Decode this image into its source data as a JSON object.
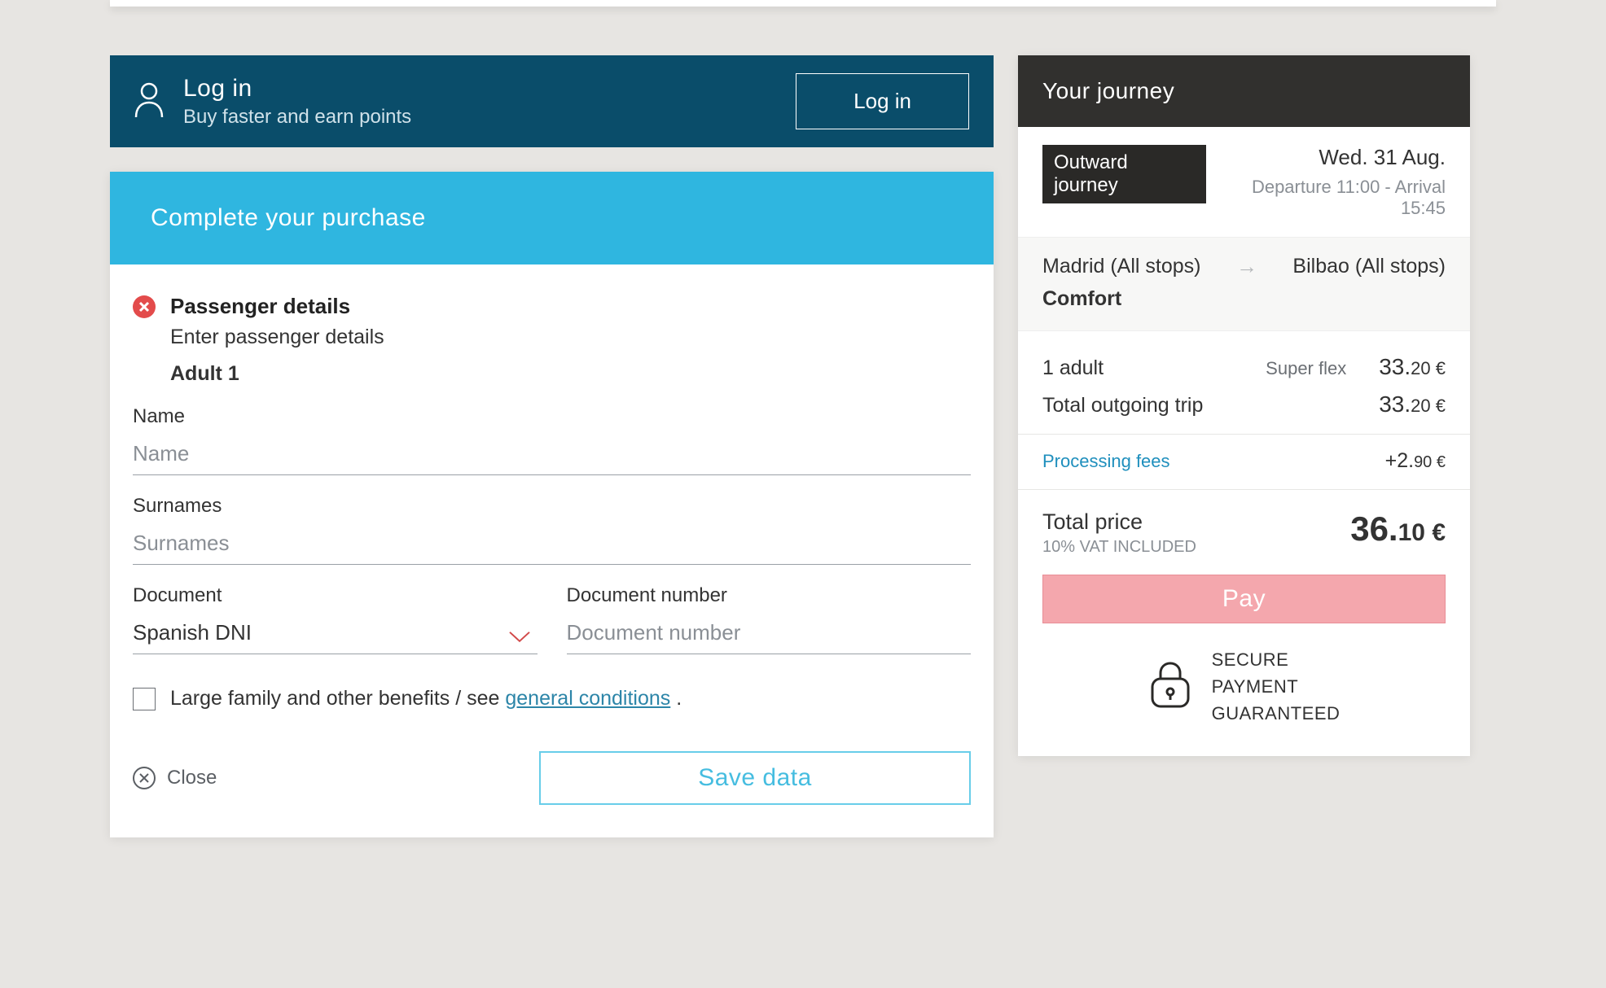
{
  "login": {
    "title": "Log in",
    "subtitle": "Buy faster and earn points",
    "button": "Log in"
  },
  "purchase": {
    "header": "Complete your purchase",
    "section_title": "Passenger details",
    "section_subtitle": "Enter passenger details",
    "person_label": "Adult 1",
    "fields": {
      "name_label": "Name",
      "name_placeholder": "Name",
      "surnames_label": "Surnames",
      "surnames_placeholder": "Surnames",
      "document_label": "Document",
      "document_value": "Spanish DNI",
      "docnum_label": "Document number",
      "docnum_placeholder": "Document number"
    },
    "benefits": {
      "text_before": "Large family and other benefits / see ",
      "link": "general conditions",
      "text_after": " ."
    },
    "close_label": "Close",
    "save_label": "Save data"
  },
  "journey": {
    "header": "Your journey",
    "badge": "Outward journey",
    "date": "Wed. 31 Aug.",
    "times": "Departure 11:00 - Arrival 15:45",
    "from": "Madrid (All stops)",
    "to": "Bilbao (All stops)",
    "class": "Comfort",
    "pax_label": "1 adult",
    "fare_label": "Super flex",
    "pax_price_int": "33.",
    "pax_price_cents": "20 €",
    "out_total_label": "Total outgoing trip",
    "out_total_int": "33.",
    "out_total_cents": "20 €",
    "fees_label": "Processing fees",
    "fees_value_int": "+2.",
    "fees_value_cents": "90 €",
    "total_label": "Total price",
    "vat_label": "10% VAT INCLUDED",
    "total_int": "36.",
    "total_cents": "10 €",
    "pay_label": "Pay",
    "secure_l1": "SECURE",
    "secure_l2": "PAYMENT",
    "secure_l3": "GUARANTEED"
  }
}
